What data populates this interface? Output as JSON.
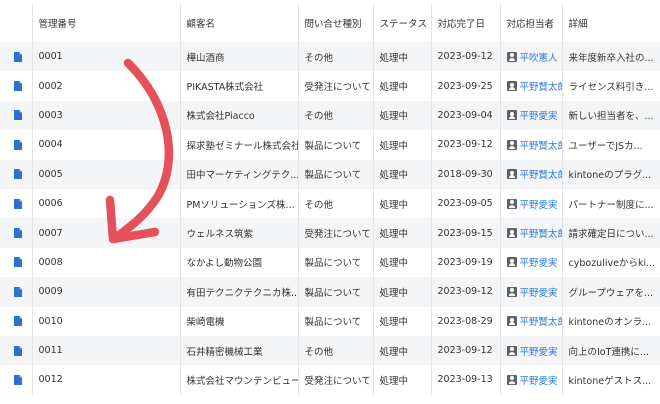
{
  "columns": [
    "管理番号",
    "顧客名",
    "問い合せ種別",
    "ステータス",
    "対応完了日",
    "対応担当者",
    "詳細"
  ],
  "rows": [
    {
      "id": "0001",
      "customer": "樺山酒商",
      "type": "その他",
      "status": "処理中",
      "date": "2023-09-12",
      "owner": "平吹憲人",
      "detail": "来年度新卒入社の..."
    },
    {
      "id": "0002",
      "customer": "PIKASTA株式会社",
      "type": "受発注について",
      "status": "処理中",
      "date": "2023-09-25",
      "owner": "平野賢太郎",
      "detail": "ライセンス料引き..."
    },
    {
      "id": "0003",
      "customer": "株式会社Piacco",
      "type": "その他",
      "status": "処理中",
      "date": "2023-09-04",
      "owner": "平野愛実",
      "detail": "新しい担当者を、..."
    },
    {
      "id": "0004",
      "customer": "探求塾ゼミナール株式会社",
      "type": "製品について",
      "status": "処理中",
      "date": "2023-09-12",
      "owner": "平野賢太郎",
      "detail": "ユーザーでJSカ..."
    },
    {
      "id": "0005",
      "customer": "田中マーケティングテク...",
      "type": "製品について",
      "status": "処理中",
      "date": "2018-09-30",
      "owner": "平野賢太郎",
      "detail": "kintoneのプラグ..."
    },
    {
      "id": "0006",
      "customer": "PMソリューションズ株...",
      "type": "その他",
      "status": "処理中",
      "date": "2023-09-05",
      "owner": "平野愛実",
      "detail": "パートナー制度に..."
    },
    {
      "id": "0007",
      "customer": "ウェルネス筑紫",
      "type": "受発注について",
      "status": "処理中",
      "date": "2023-09-15",
      "owner": "平野賢太郎",
      "detail": "請求確定日につい..."
    },
    {
      "id": "0008",
      "customer": "なかよし動物公園",
      "type": "製品について",
      "status": "処理中",
      "date": "2023-09-19",
      "owner": "平野愛実",
      "detail": "cybozuliveからki..."
    },
    {
      "id": "0009",
      "customer": "有田テクニクテクニカ株...",
      "type": "製品について",
      "status": "処理中",
      "date": "2023-09-12",
      "owner": "平野愛実",
      "detail": "グループウェアを..."
    },
    {
      "id": "0010",
      "customer": "柴崎電機",
      "type": "製品について",
      "status": "処理中",
      "date": "2023-08-29",
      "owner": "平野賢太郎",
      "detail": "kintoneのオンラ..."
    },
    {
      "id": "0011",
      "customer": "石井精密機械工業",
      "type": "その他",
      "status": "処理中",
      "date": "2023-09-12",
      "owner": "平野愛実",
      "detail": "向上のIoT連携に..."
    },
    {
      "id": "0012",
      "customer": "株式会社マウンテンビュー",
      "type": "受発注について",
      "status": "処理中",
      "date": "2023-09-13",
      "owner": "平野愛実",
      "detail": "kintoneゲストス..."
    }
  ],
  "icons": {
    "row": "document-icon",
    "owner": "user-icon",
    "annotation": "curved-arrow"
  },
  "colors": {
    "link": "#2c7bd8",
    "doc_icon": "#2e6fd1",
    "arrow": "#e5505a",
    "stripe": "#f4f5f6"
  }
}
